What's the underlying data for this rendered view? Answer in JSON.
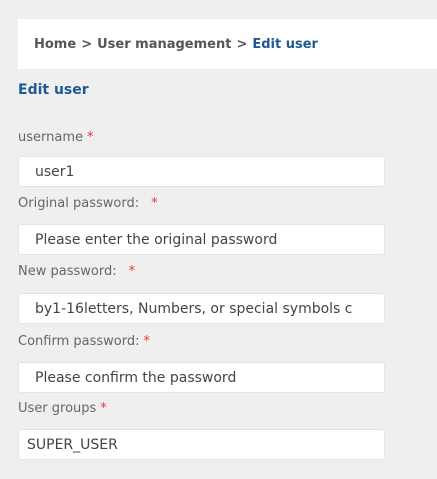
{
  "breadcrumb": {
    "home": "Home",
    "separator": ">",
    "section": "User management",
    "current": "Edit user"
  },
  "page_title": "Edit user",
  "form": {
    "username": {
      "label": "username",
      "required_mark": "*",
      "value": "user1"
    },
    "original_password": {
      "label": "Original password:",
      "required_mark": "*",
      "placeholder": "Please enter the original password"
    },
    "new_password": {
      "label": "New password:",
      "required_mark": "*",
      "placeholder": "by1-16letters, Numbers, or special symbols c"
    },
    "confirm_password": {
      "label": "Confirm password:",
      "required_mark": "*",
      "placeholder": "Please confirm the password"
    },
    "user_groups": {
      "label": "User groups",
      "required_mark": "*",
      "value": "SUPER_USER"
    }
  },
  "colors": {
    "background": "#efefef",
    "accent_blue": "#1e5a92",
    "required_red": "#e03a3a"
  }
}
